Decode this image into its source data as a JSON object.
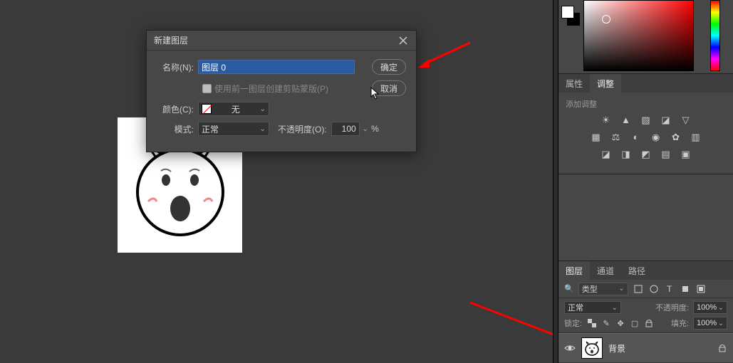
{
  "dialog": {
    "title": "新建图层",
    "name_label": "名称(N):",
    "name_value": "图层 0",
    "ok_label": "确定",
    "cancel_label": "取消",
    "clip_label": "使用前一图层创建剪贴蒙版(P)",
    "color_label": "颜色(C):",
    "color_value": "无",
    "mode_label": "模式:",
    "mode_value": "正常",
    "opacity_label": "不透明度(O):",
    "opacity_value": "100",
    "opacity_suffix": "%"
  },
  "properties": {
    "tab_properties": "属性",
    "tab_adjust": "调整",
    "add_label": "添加调整"
  },
  "layers": {
    "tab_layers": "图层",
    "tab_channels": "通道",
    "tab_paths": "路径",
    "filter_type": "类型",
    "blend_mode": "正常",
    "opacity_label": "不透明度:",
    "opacity_value": "100%",
    "lock_label": "锁定:",
    "fill_label": "填充:",
    "fill_value": "100%",
    "layer_name": "背景",
    "search_icon": "🔍"
  }
}
